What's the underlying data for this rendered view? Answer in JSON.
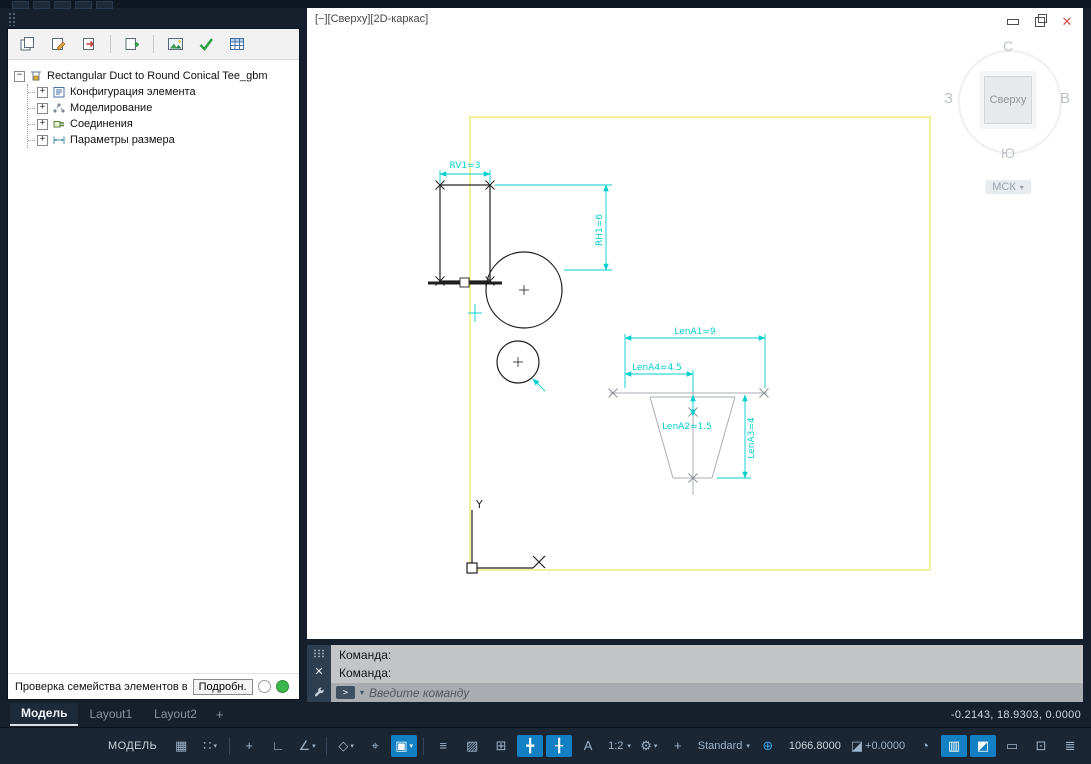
{
  "colors": {
    "accent_cyan": "#00cfcf",
    "boundary_yellow": "#e6e63c",
    "active_blue": "#1380c4",
    "check_green": "#2fa043",
    "close_red": "#d85050"
  },
  "left_panel": {
    "tree": {
      "root_label": "Rectangular Duct to Round Conical Tee_gbm",
      "root_expander": "−",
      "child_expander": "+",
      "items": [
        {
          "label": "Конфигурация элемента"
        },
        {
          "label": "Моделирование"
        },
        {
          "label": "Соединения"
        },
        {
          "label": "Параметры размера"
        }
      ]
    },
    "footer": {
      "label": "Проверка семейства элементов в",
      "details_button": "Подробн."
    }
  },
  "viewport": {
    "header": "[−][Сверху][2D-каркас]",
    "window_buttons": {
      "close": "✕"
    },
    "viewcube": {
      "north": "С",
      "east": "В",
      "south": "Ю",
      "west": "З",
      "face": "Сверху",
      "cs_label": "МСК",
      "cs_caret": "▾"
    },
    "ucs": {
      "y": "Y"
    },
    "dimensions": {
      "rv1": "RV1=3",
      "rh1": "RH1=6",
      "lenA1": "LenA1=9",
      "lenA4": "LenA4=4.5",
      "lenA2": "LenA2=1.5",
      "lenA3": "LenA3=4"
    }
  },
  "command_line": {
    "history": [
      "Команда:",
      "Команда:"
    ],
    "chip": ">",
    "chip_caret": "▾",
    "close": "✕",
    "prompt": "Введите команду"
  },
  "tabs": {
    "model": "Модель",
    "layout1": "Layout1",
    "layout2": "Layout2",
    "add": "+"
  },
  "coordinates": "-0.2143, 18.9303, 0.0000",
  "status_bar": {
    "model_space": "МОДЕЛЬ",
    "scale": "1:2",
    "style": "Standard",
    "value": "1066.8000",
    "elevation": "+0.0000",
    "caret": "▾",
    "glyphs": {
      "grid": "▦",
      "snap": "∷",
      "dynamic_input": "+",
      "ortho": "∟",
      "polar": "∠",
      "isodraft": "◇",
      "otrack": "⌖",
      "osnap": "▣",
      "lineweight": "≡",
      "transparency": "▨",
      "selection_cycling": "⊞",
      "osnap3d": "╋",
      "dynamic_ucs": "╂",
      "annotation_monitor": "А",
      "workspace_gear": "⚙",
      "annotation_add": "+",
      "geolocation": "⊕",
      "elevation_icon": "◪",
      "isolate": "◔",
      "hatch": "▥",
      "performance": "◩",
      "monitor": "▭",
      "clean_screen": "⊡",
      "customization": "≣"
    }
  }
}
